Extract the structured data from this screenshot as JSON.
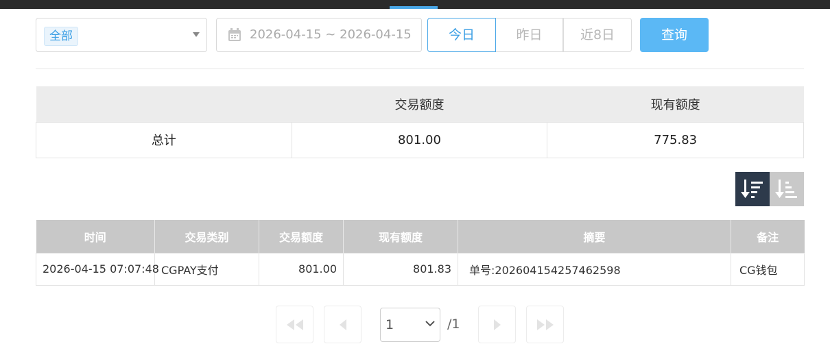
{
  "filters": {
    "category_selected": "全部",
    "date_range": "2026-04-15 ~ 2026-04-15",
    "quick_ranges": [
      "今日",
      "昨日",
      "近8日"
    ],
    "search_label": "查询"
  },
  "summary": {
    "headers": [
      "",
      "交易额度",
      "现有额度"
    ],
    "row": {
      "label": "总计",
      "trade_amount": "801.00",
      "current_amount": "775.83"
    }
  },
  "sort_buttons": [
    "sort-descending-icon",
    "sort-ascending-icon"
  ],
  "records": {
    "headers": [
      "时间",
      "交易类别",
      "交易额度",
      "现有额度",
      "摘要",
      "备注"
    ],
    "rows": [
      {
        "time": "2026-04-15 07:07:48",
        "type": "CGPAY支付",
        "trade_amount": "801.00",
        "current_amount": "801.83",
        "summary": "单号:202604154257462598",
        "remark": "CG钱包"
      }
    ]
  },
  "pager": {
    "current_page": "1",
    "total": "/1"
  },
  "colors": {
    "accent": "#4aa8e8",
    "primary_button": "#5bb8f5",
    "header_gray": "#c8c8c8",
    "sort_active": "#2d3a4b"
  }
}
